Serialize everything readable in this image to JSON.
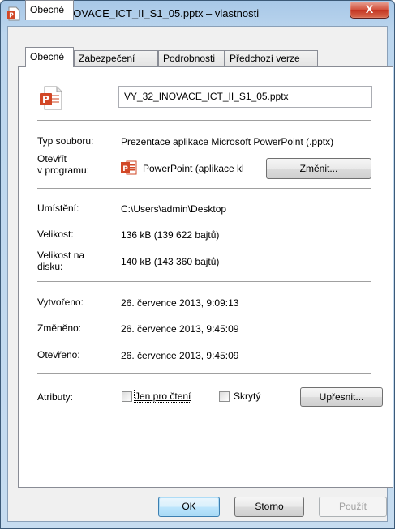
{
  "window": {
    "title": "VY_32_INOVACE_ICT_II_S1_05.pptx – vlastnosti",
    "close_label": "X"
  },
  "tabs": [
    {
      "label": "Obecné",
      "active": true
    },
    {
      "label": "Zabezpečení",
      "active": false
    },
    {
      "label": "Podrobnosti",
      "active": false
    },
    {
      "label": "Předchozí verze",
      "active": false
    }
  ],
  "general": {
    "filename": "VY_32_INOVACE_ICT_II_S1_05.pptx",
    "file_type_label": "Typ souboru:",
    "file_type_value": "Prezentace aplikace Microsoft PowerPoint (.pptx)",
    "opens_with_label_1": "Otevřít",
    "opens_with_label_2": "v programu:",
    "opens_with_value": "PowerPoint (aplikace kl",
    "change_button": "Změnit...",
    "location_label": "Umístění:",
    "location_value": "C:\\Users\\admin\\Desktop",
    "size_label": "Velikost:",
    "size_value": "136 kB (139 622 bajtů)",
    "size_on_disk_label_1": "Velikost na",
    "size_on_disk_label_2": "disku:",
    "size_on_disk_value": "140 kB (143 360 bajtů)",
    "created_label": "Vytvořeno:",
    "created_value": "26. července 2013, 9:09:13",
    "modified_label": "Změněno:",
    "modified_value": "26. července 2013, 9:45:09",
    "accessed_label": "Otevřeno:",
    "accessed_value": "26. července 2013, 9:45:09",
    "attributes_label": "Atributy:",
    "readonly_label": "Jen pro čtení",
    "readonly_checked": false,
    "hidden_label": "Skrytý",
    "hidden_checked": false,
    "advanced_button": "Upřesnit..."
  },
  "footer": {
    "ok": "OK",
    "cancel": "Storno",
    "apply": "Použít"
  },
  "colors": {
    "ppt_orange": "#d24726",
    "close_red": "#c33422"
  },
  "icons": {
    "title": "powerpoint-file-icon",
    "file": "powerpoint-document-icon",
    "app": "powerpoint-app-icon"
  }
}
